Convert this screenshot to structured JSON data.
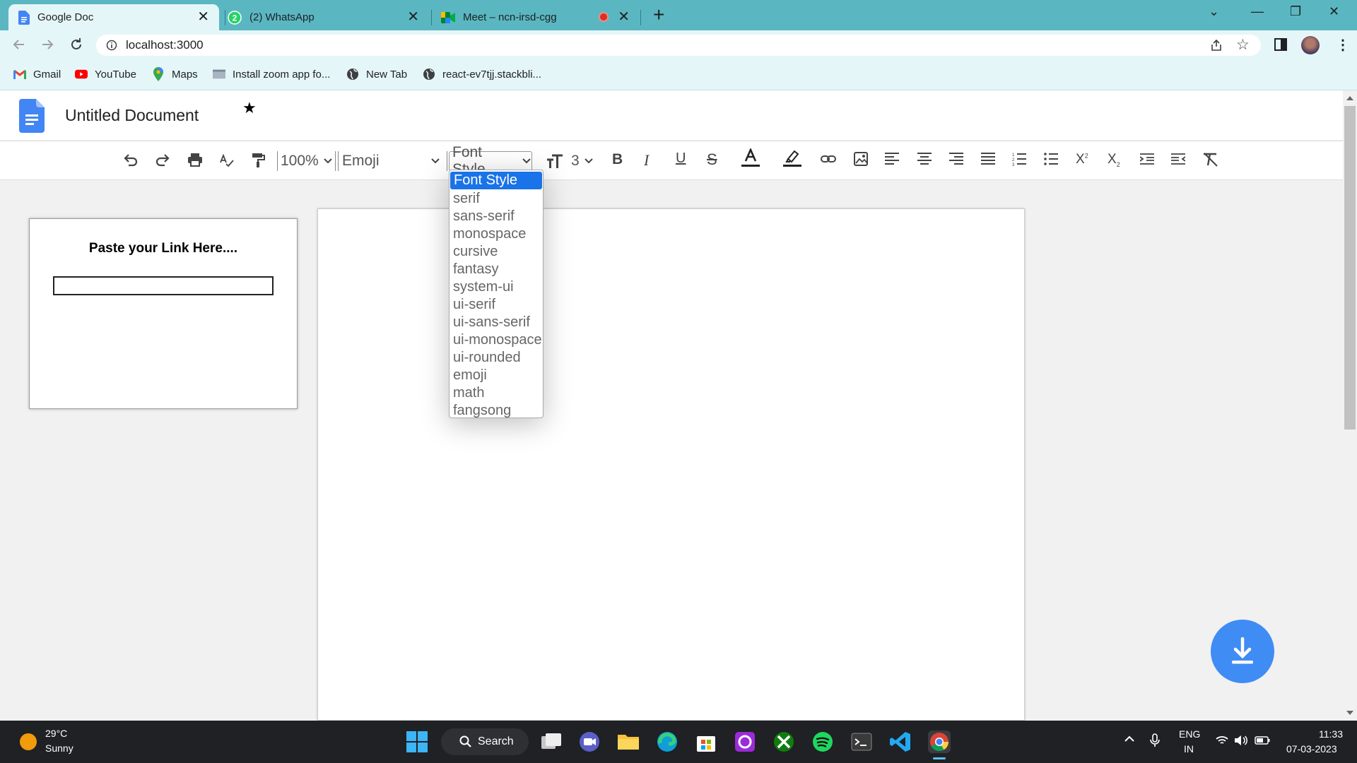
{
  "browser": {
    "tabs": [
      {
        "title": "Google Doc",
        "active": true
      },
      {
        "title": "(2) WhatsApp",
        "active": false
      },
      {
        "title": "Meet – ncn-irsd-cgg",
        "active": false
      }
    ],
    "url": "localhost:3000",
    "bookmarks": [
      {
        "label": "Gmail",
        "icon": "gmail-icon"
      },
      {
        "label": "YouTube",
        "icon": "youtube-icon"
      },
      {
        "label": "Maps",
        "icon": "maps-icon"
      },
      {
        "label": "Install zoom app fo...",
        "icon": "zoom-icon"
      },
      {
        "label": "New Tab",
        "icon": "globe-icon"
      },
      {
        "label": "react-ev7tjj.stackbli...",
        "icon": "globe-icon"
      }
    ]
  },
  "app": {
    "title": "Untitled Document",
    "toolbar": {
      "zoom": "100%",
      "font_family": "Emoji",
      "font_style": "Font Style",
      "font_size": "3"
    },
    "link_panel": {
      "title": "Paste your Link Here....",
      "input_value": ""
    },
    "font_style_options": [
      "Font Style",
      "serif",
      "sans-serif",
      "monospace",
      "cursive",
      "fantasy",
      "system-ui",
      "ui-serif",
      "ui-sans-serif",
      "ui-monospace",
      "ui-rounded",
      "emoji",
      "math",
      "fangsong"
    ],
    "selected_option_index": 0
  },
  "taskbar": {
    "weather_temp": "29°C",
    "weather_condition": "Sunny",
    "search_label": "Search",
    "language_top": "ENG",
    "language_bottom": "IN",
    "time": "11:33",
    "date": "07-03-2023"
  },
  "colors": {
    "tabstrip": "#5ab7c2",
    "toolbar_bg": "#e5f6f8",
    "accent": "#1a73e8",
    "fab": "#3f8cf5"
  }
}
